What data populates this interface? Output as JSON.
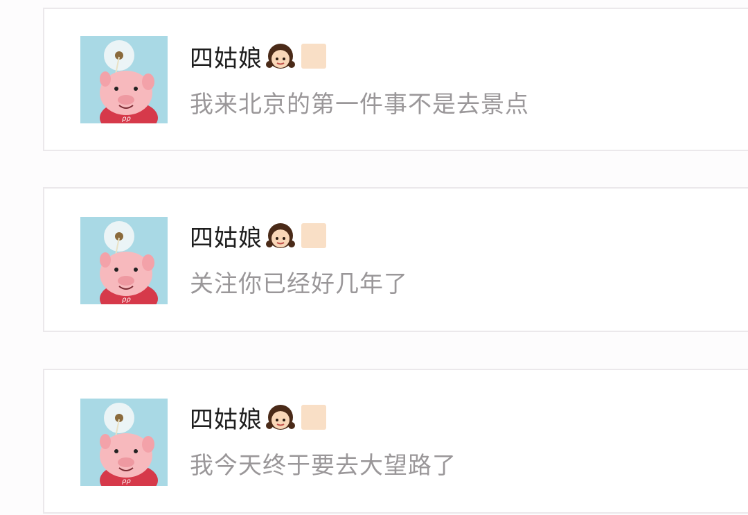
{
  "colors": {
    "avatar_bg": "#a9d9e5",
    "skin_tone_swatch": "#f9dfc6",
    "username_text": "#1e1e1e",
    "message_text": "#9a9799"
  },
  "comments": [
    {
      "username": "四姑娘",
      "emoji": "girl-emoji",
      "tone": "skin-tone-modifier",
      "message": "我来北京的第一件事不是去景点"
    },
    {
      "username": "四姑娘",
      "emoji": "girl-emoji",
      "tone": "skin-tone-modifier",
      "message": "关注你已经好几年了"
    },
    {
      "username": "四姑娘",
      "emoji": "girl-emoji",
      "tone": "skin-tone-modifier",
      "message": "我今天终于要去大望路了"
    }
  ]
}
